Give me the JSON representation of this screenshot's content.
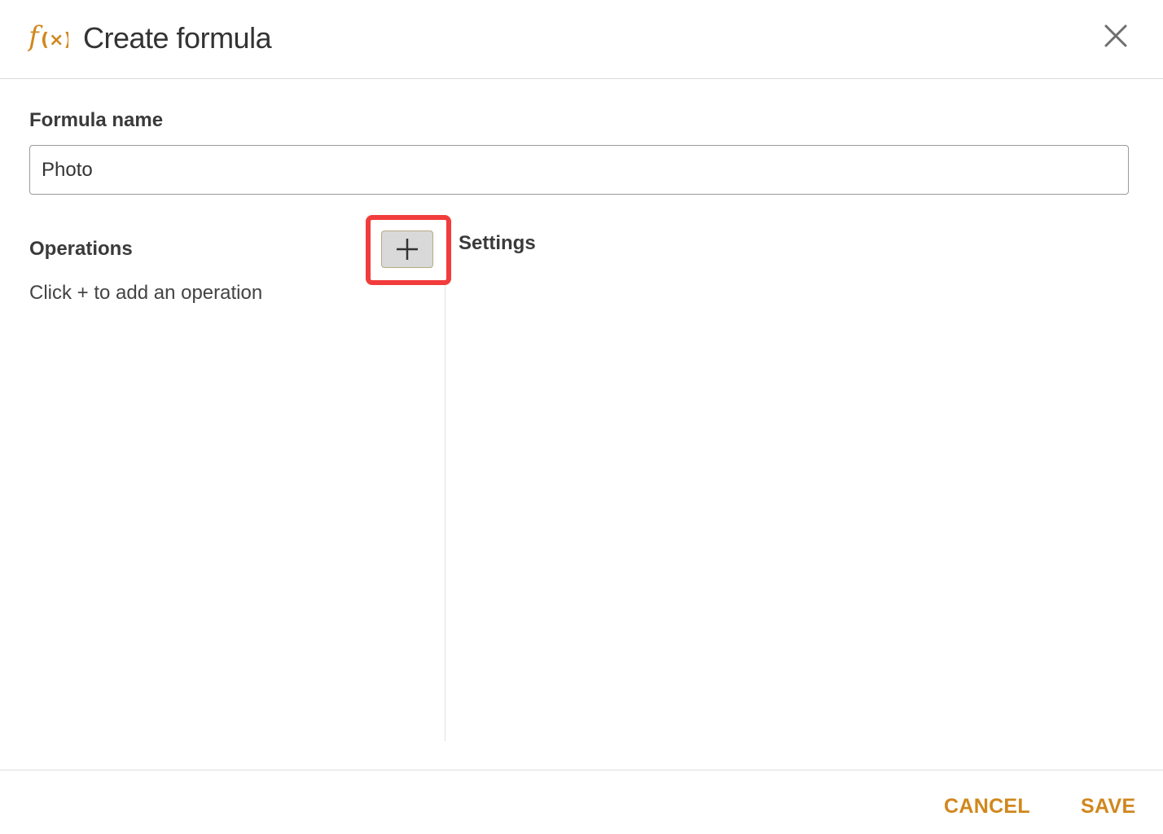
{
  "header": {
    "title": "Create formula",
    "icon": "function-fx-icon",
    "accent_color": "#d1871d"
  },
  "form": {
    "name_label": "Formula name",
    "name_value": "Photo"
  },
  "operations": {
    "label": "Operations",
    "hint": "Click + to add an operation",
    "add_icon": "plus-icon"
  },
  "settings": {
    "label": "Settings"
  },
  "footer": {
    "cancel_label": "CANCEL",
    "save_label": "SAVE"
  },
  "highlight_color": "#f23c3c"
}
